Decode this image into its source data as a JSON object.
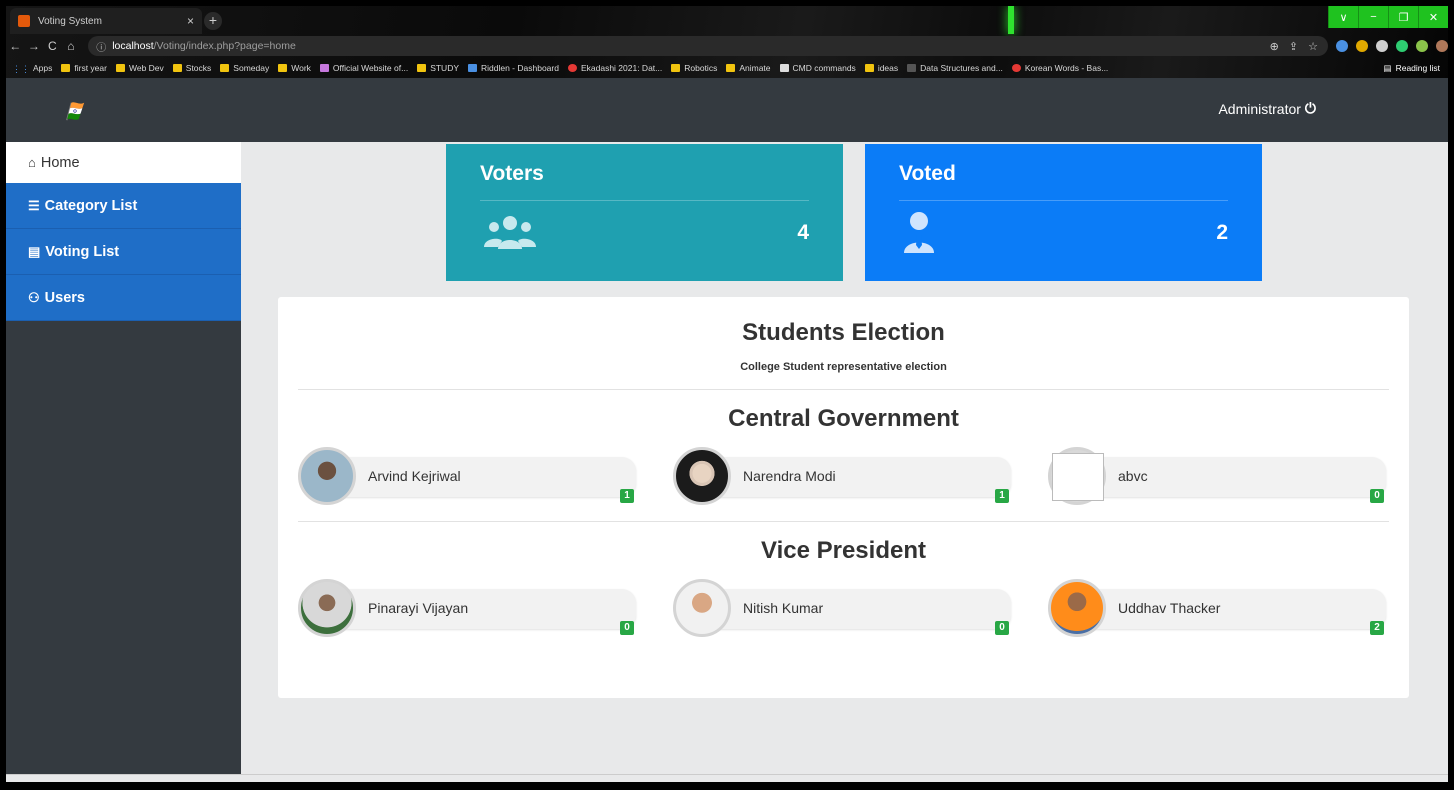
{
  "browser": {
    "tab_title": "Voting System",
    "tab_close": "×",
    "new_tab": "+",
    "url_host": "localhost",
    "url_path": "/Voting/index.php?page=home",
    "nav": [
      "←",
      "→",
      "C",
      "⌂"
    ],
    "window_buttons": [
      "∨",
      "−",
      "❐",
      "✕"
    ],
    "bookmarks": [
      "Apps",
      "first year",
      "Web Dev",
      "Stocks",
      "Someday",
      "Work",
      "Official Website of...",
      "STUDY",
      "Riddlen - Dashboard",
      "Ekadashi 2021: Dat...",
      "Robotics",
      "Animate",
      "CMD commands",
      "ideas",
      "Data Structures and...",
      "Korean Words - Bas..."
    ],
    "reading_list": "Reading list"
  },
  "header": {
    "user_name": "Administrator",
    "power_icon": "⏻"
  },
  "sidebar": {
    "items": [
      {
        "label": "Home",
        "icon": "⌂",
        "icon_name": "home-icon"
      },
      {
        "label": "Category List",
        "icon": "☰",
        "icon_name": "list-icon"
      },
      {
        "label": "Voting List",
        "icon": "▤",
        "icon_name": "poll-icon"
      },
      {
        "label": "Users",
        "icon": "⚇",
        "icon_name": "users-icon"
      }
    ]
  },
  "stats": {
    "voters": {
      "title": "Voters",
      "value": "4"
    },
    "voted": {
      "title": "Voted",
      "value": "2"
    }
  },
  "election": {
    "title": "Students Election",
    "subtitle": "College Student representative election",
    "categories": [
      {
        "name": "Central Government",
        "candidates": [
          {
            "name": "Arvind Kejriwal",
            "votes": "1"
          },
          {
            "name": "Narendra Modi",
            "votes": "1"
          },
          {
            "name": "abvc",
            "votes": "0"
          }
        ]
      },
      {
        "name": "Vice President",
        "candidates": [
          {
            "name": "Pinarayi Vijayan",
            "votes": "0"
          },
          {
            "name": "Nitish Kumar",
            "votes": "0"
          },
          {
            "name": "Uddhav Thacker",
            "votes": "2"
          }
        ]
      }
    ]
  },
  "colors": {
    "nav_bg": "#343a40",
    "sidebar_active_bg": "#1f6ec7",
    "voters_card": "#1fa0b0",
    "voted_card": "#0b7cf7",
    "badge": "#28a745"
  }
}
